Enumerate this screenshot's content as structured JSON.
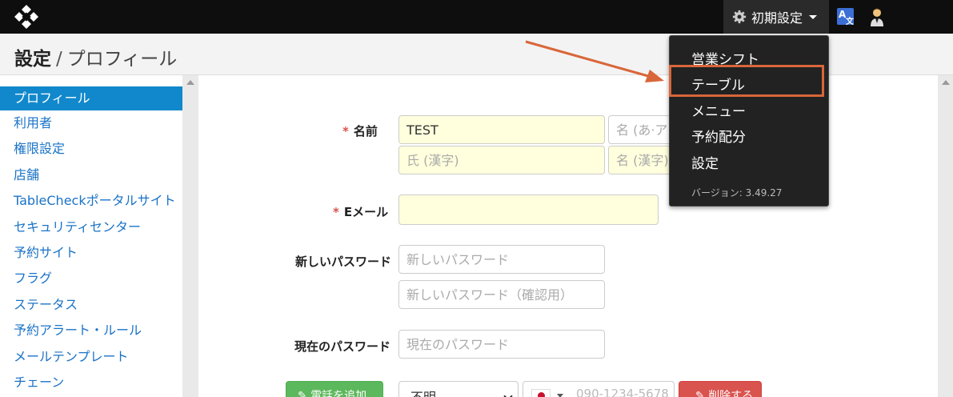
{
  "topbar": {
    "settings_menu_label": "初期設定",
    "lang_icon": "translate-icon",
    "user_icon": "user-icon"
  },
  "breadcrumb": {
    "first": "設定",
    "separator": "/",
    "current": "プロフィール"
  },
  "sidebar": {
    "items": [
      "プロフィール",
      "利用者",
      "権限設定",
      "店舗",
      "TableCheckポータルサイト",
      "セキュリティセンター",
      "予約サイト",
      "フラグ",
      "ステータス",
      "予約アラート・ルール",
      "メールテンプレート",
      "チェーン"
    ],
    "active_index": 0
  },
  "form": {
    "name_label": "名前",
    "required_mark": "*",
    "last_name_value": "TEST",
    "first_name_kana_placeholder": "名 (あ·ア·A)",
    "last_name_kanji_placeholder": "氏 (漢字)",
    "first_name_kanji_placeholder": "名 (漢字)",
    "email_label": "Eメール",
    "email_value": "",
    "new_password_label": "新しいパスワード",
    "new_password_placeholder": "新しいパスワード",
    "confirm_password_placeholder": "新しいパスワード（確認用）",
    "current_password_label": "現在のパスワード",
    "current_password_placeholder": "現在のパスワード",
    "add_phone_button": "電話を追加",
    "phone_type_value": "不明",
    "phone_placeholder": "090-1234-5678",
    "delete_button": "削除する"
  },
  "dropdown": {
    "items": [
      "営業シフト",
      "テーブル",
      "メニュー",
      "予約配分",
      "設定"
    ],
    "highlighted_index": 1,
    "version": "バージョン: 3.49.27"
  },
  "colors": {
    "topbar": "#0e0e0e",
    "active_sidebar": "#1188cc",
    "link": "#1a73c7",
    "highlight": "#d9663a",
    "input_yellow": "#ffffdd"
  }
}
